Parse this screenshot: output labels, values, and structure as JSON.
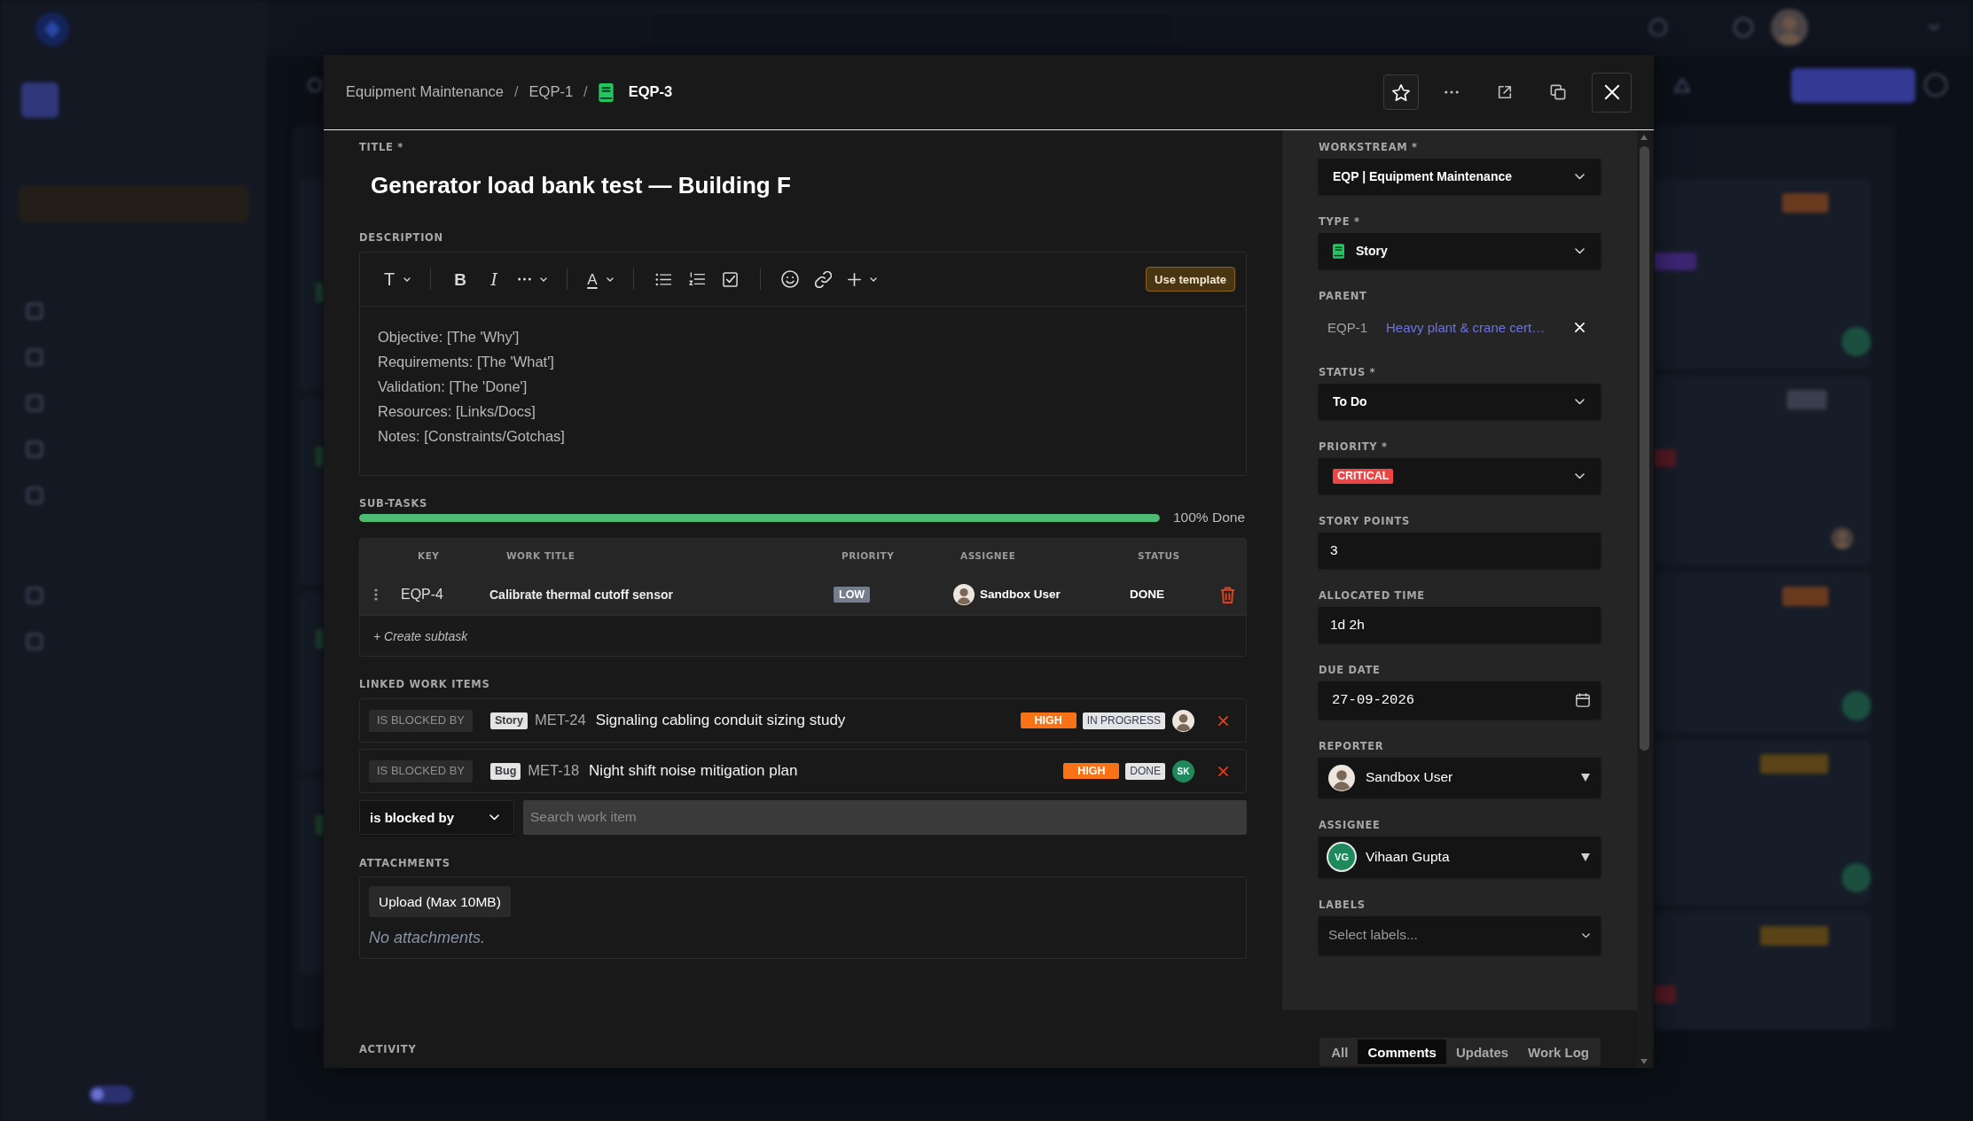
{
  "sidebar": {
    "toggle": {
      "on": false
    }
  },
  "header": {
    "breadcrumbs": [
      "Equipment Maintenance",
      "EQP-1"
    ],
    "separator": "/",
    "current_key": "EQP-3"
  },
  "title": {
    "label": "TITLE *",
    "value": "Generator load bank test — Building F"
  },
  "description": {
    "label": "DESCRIPTION",
    "toolbar": {
      "text_style": "T",
      "bold": "B",
      "italic": "I",
      "text_color": "A"
    },
    "template_button": "Use template",
    "lines": [
      "Objective: [The 'Why']",
      "Requirements: [The 'What']",
      "Validation: [The 'Done']",
      "Resources: [Links/Docs]",
      "Notes: [Constraints/Gotchas]"
    ]
  },
  "subtasks": {
    "label": "SUB-TASKS",
    "progress": {
      "level": 1,
      "reading": "100% Done"
    },
    "columns": [
      "KEY",
      "WORK TITLE",
      "PRIORITY",
      "ASSIGNEE",
      "STATUS"
    ],
    "rows": [
      {
        "key": "EQP-4",
        "title": "Calibrate thermal cutoff sensor",
        "priority": {
          "label": "LOW",
          "color": "#737d8c"
        },
        "assignee": {
          "name": "Sandbox User",
          "avatar": {
            "kind": "photo"
          }
        },
        "status": "DONE"
      }
    ],
    "create_link": "+ Create subtask"
  },
  "linked_items": {
    "label": "LINKED WORK ITEMS",
    "rows": [
      {
        "relation": "IS BLOCKED BY",
        "type": "Story",
        "key": "MET-24",
        "title": "Signaling cabling conduit sizing study",
        "priority": {
          "label": "HIGH",
          "color": "#f97316"
        },
        "status": "IN PROGRESS",
        "avatar": {
          "kind": "photo"
        }
      },
      {
        "relation": "IS BLOCKED BY",
        "type": "Bug",
        "key": "MET-18",
        "title": "Night shift noise mitigation plan",
        "priority": {
          "label": "HIGH",
          "color": "#f97316"
        },
        "status": "DONE",
        "avatar": {
          "kind": "initials",
          "initials": "SK",
          "color": "#1e8a5c"
        }
      }
    ],
    "relation_select": "is blocked by",
    "search": {
      "placeholder": "Search work item"
    }
  },
  "attachments": {
    "label": "ATTACHMENTS",
    "upload_button": "Upload (Max 10MB)",
    "empty_text": "No attachments."
  },
  "details": [
    {
      "kind": "select",
      "label": "WORKSTREAM *",
      "value": "EQP | Equipment Maintenance"
    },
    {
      "kind": "type_select",
      "label": "TYPE *",
      "value": "Story"
    },
    {
      "kind": "parent",
      "label": "PARENT",
      "key": "EQP-1",
      "title": "Heavy plant & crane cert…"
    },
    {
      "kind": "select",
      "label": "STATUS *",
      "value": "To Do"
    },
    {
      "kind": "priority_select",
      "label": "PRIORITY *",
      "value": "CRITICAL",
      "color": "#ef4444"
    },
    {
      "kind": "input",
      "label": "STORY POINTS",
      "value": "3"
    },
    {
      "kind": "input",
      "label": "ALLOCATED TIME",
      "value": "1d 2h"
    },
    {
      "kind": "date",
      "label": "DUE DATE",
      "value": "27-09-2026"
    },
    {
      "kind": "user_select",
      "label": "REPORTER",
      "value": "Sandbox User",
      "avatar": {
        "kind": "photo"
      }
    },
    {
      "kind": "user_select",
      "label": "ASSIGNEE",
      "value": "Vihaan Gupta",
      "avatar": {
        "kind": "initials",
        "initials": "VG",
        "color": "#1e8a5c"
      }
    },
    {
      "kind": "multiselect",
      "label": "LABELS",
      "placeholder": "Select labels..."
    }
  ],
  "activity": {
    "label": "ACTIVITY",
    "tabs": [
      {
        "label": "All",
        "selected": false
      },
      {
        "label": "Comments",
        "selected": true
      },
      {
        "label": "Updates",
        "selected": false
      },
      {
        "label": "Work Log",
        "selected": false
      }
    ]
  }
}
